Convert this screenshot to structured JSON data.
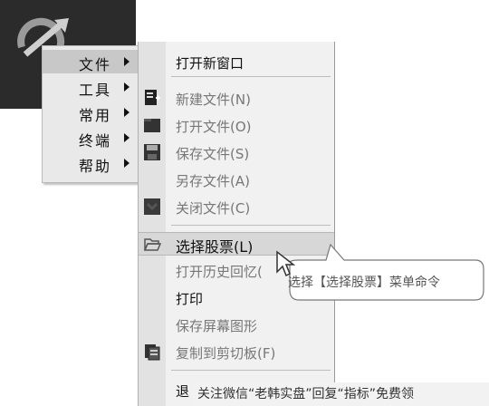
{
  "main_menu": {
    "items": [
      {
        "label": "文件",
        "selected": true,
        "has_submenu": true
      },
      {
        "label": "工具",
        "selected": false,
        "has_submenu": true
      },
      {
        "label": "常用",
        "selected": false,
        "has_submenu": true
      },
      {
        "label": "终端",
        "selected": false,
        "has_submenu": true
      },
      {
        "label": "帮助",
        "selected": false,
        "has_submenu": true
      }
    ]
  },
  "sub_menu": {
    "items": [
      {
        "label": "打开新窗口",
        "icon": "",
        "enabled": true
      },
      {
        "label": "新建文件(N)",
        "icon": "new-file-icon",
        "enabled": false
      },
      {
        "label": "打开文件(O)",
        "icon": "folder-icon",
        "enabled": false
      },
      {
        "label": "保存文件(S)",
        "icon": "save-icon",
        "enabled": false
      },
      {
        "label": "另存文件(A)",
        "icon": "",
        "enabled": false
      },
      {
        "label": "关闭文件(C)",
        "icon": "close-file-icon",
        "enabled": false
      },
      {
        "label": "选择股票(L)",
        "icon": "open-folder-icon",
        "enabled": true,
        "selected": true
      },
      {
        "label": "打开历史回忆(",
        "icon": "",
        "enabled": false
      },
      {
        "label": "打印",
        "icon": "",
        "enabled": true
      },
      {
        "label": "保存屏幕图形",
        "icon": "",
        "enabled": false
      },
      {
        "label": "复制到剪切板(F)",
        "icon": "clipboard-icon",
        "enabled": false
      },
      {
        "label": "退",
        "icon": "",
        "enabled": true
      }
    ]
  },
  "callout": {
    "text": "选择【选择股票】菜单命令"
  },
  "watermark": {
    "text": "关注微信“老韩实盘”回复“指标”免费领"
  },
  "colors": {
    "logo_bg": "#2b2b2b",
    "menu_bg": "#e9e9e9",
    "selected_bg": "#c8c8c8",
    "submenu_bg": "#f1f1f1"
  }
}
